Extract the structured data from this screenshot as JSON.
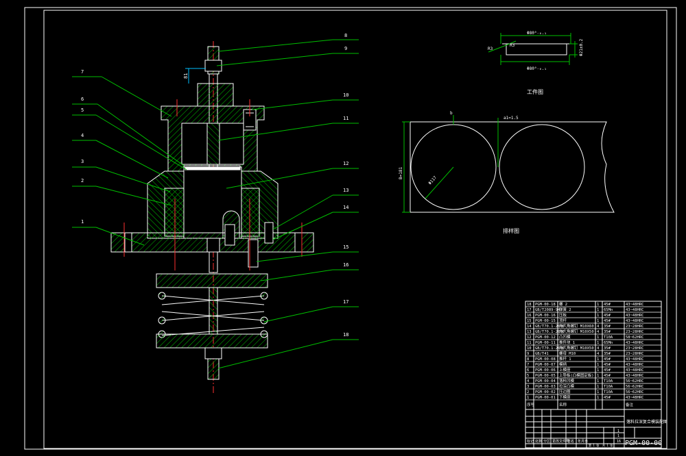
{
  "drawing_no": "PGM-00-00",
  "callouts": [
    "1",
    "2",
    "3",
    "4",
    "5",
    "6",
    "7",
    "8",
    "9",
    "10",
    "11",
    "12",
    "13",
    "14",
    "15",
    "16",
    "17",
    "18"
  ],
  "dims": {
    "d1": "81",
    "wp_top": "Φ80⁰₋₀.₁",
    "wp_r1": "R3",
    "wp_r2": "R3",
    "wp_h": "Φ21±0.2",
    "wp_bot": "Φ80⁰₋₀.₁",
    "st_a": "b",
    "st_gap": "a1=1.5",
    "st_w": "B=181",
    "st_d": "Φ117"
  },
  "views": {
    "workpiece_label": "工件图",
    "strip_label": "排样图"
  },
  "bom": {
    "rows": [
      [
        "18",
        "PGM-00-18",
        "螺 2",
        "1",
        "45#",
        "43~48HRC"
      ],
      [
        "17",
        "GB/T2089-94",
        "弹簧 2",
        "1",
        "65Mn",
        "43~48HRC"
      ],
      [
        "16",
        "PGM-00-16",
        "压板",
        "1",
        "45#",
        "43~48HRC"
      ],
      [
        "15",
        "PGM-00-15",
        "顶杆",
        "1",
        "45#",
        "43~48HRC"
      ],
      [
        "14",
        "GB/T70.1-2000",
        "内六角螺钉 M10X60",
        "4",
        "35#",
        "23~28HRC"
      ],
      [
        "13",
        "GB/T70.1-2000",
        "内六角螺钉 M10X50",
        "4",
        "35#",
        "23~28HRC"
      ],
      [
        "12",
        "PGM-00-12",
        "凸凹模",
        "1",
        "T10A",
        "58~62HRC"
      ],
      [
        "11",
        "PGM-00-11",
        "推件块 1",
        "1",
        "65Mn",
        "43~48HRC"
      ],
      [
        "10",
        "GB/T70.1-2000",
        "内六角螺钉 M10X50",
        "4",
        "35#",
        "23~28HRC"
      ],
      [
        "9",
        "GB/T41",
        "螺母 M10",
        "4",
        "35#",
        "23~28HRC"
      ],
      [
        "8",
        "PGM-00-08",
        "推杆 1",
        "1",
        "45#",
        "43~48HRC"
      ],
      [
        "7",
        "PGM-00-07",
        "模柄",
        "1",
        "45#",
        "43~48HRC"
      ],
      [
        "6",
        "PGM-00-06",
        "上模座",
        "1",
        "45#",
        "43~48HRC"
      ],
      [
        "5",
        "PGM-00-05",
        "上垫板(凸模固定板)",
        "1",
        "45#",
        "43~48HRC"
      ],
      [
        "4",
        "PGM-00-04",
        "落料凹模",
        "1",
        "T10A",
        "56~62HRC"
      ],
      [
        "3",
        "PGM-00-03",
        "拉深凸模",
        "1",
        "T10A",
        "56~62HRC"
      ],
      [
        "2",
        "PGM-00-02",
        "压边圈",
        "1",
        "T10A",
        "56~62HRC"
      ],
      [
        "1",
        "PGM-00-01",
        "下模座",
        "1",
        "45#",
        "43~48HRC"
      ]
    ],
    "header": [
      "序号",
      "",
      "名称",
      "",
      "",
      "备注"
    ]
  },
  "title_block": {
    "title": "落料拉深复合模装配图",
    "scale": "1",
    "sheets": "1",
    "count": "16",
    "row_labels": [
      "标记",
      "处数",
      "分区",
      "更改文件号",
      "签名",
      "年月日"
    ],
    "footer": [
      "第 1 张",
      "共 1 张"
    ]
  }
}
